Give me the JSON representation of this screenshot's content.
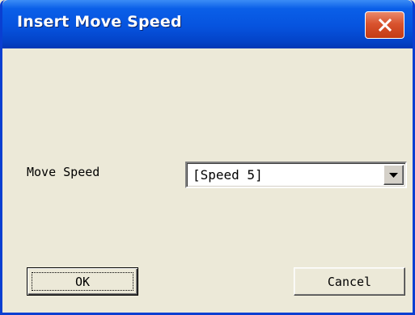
{
  "window": {
    "title": "Insert Move Speed",
    "close_icon": "close-icon"
  },
  "form": {
    "move_speed_label": "Move Speed",
    "move_speed_value": "[Speed 5]",
    "dropdown_icon": "chevron-down-icon"
  },
  "buttons": {
    "ok_label": "OK",
    "cancel_label": "Cancel"
  },
  "colors": {
    "titlebar": "#0653de",
    "close_button": "#d9532e",
    "dialog_background": "#ece9d8"
  }
}
